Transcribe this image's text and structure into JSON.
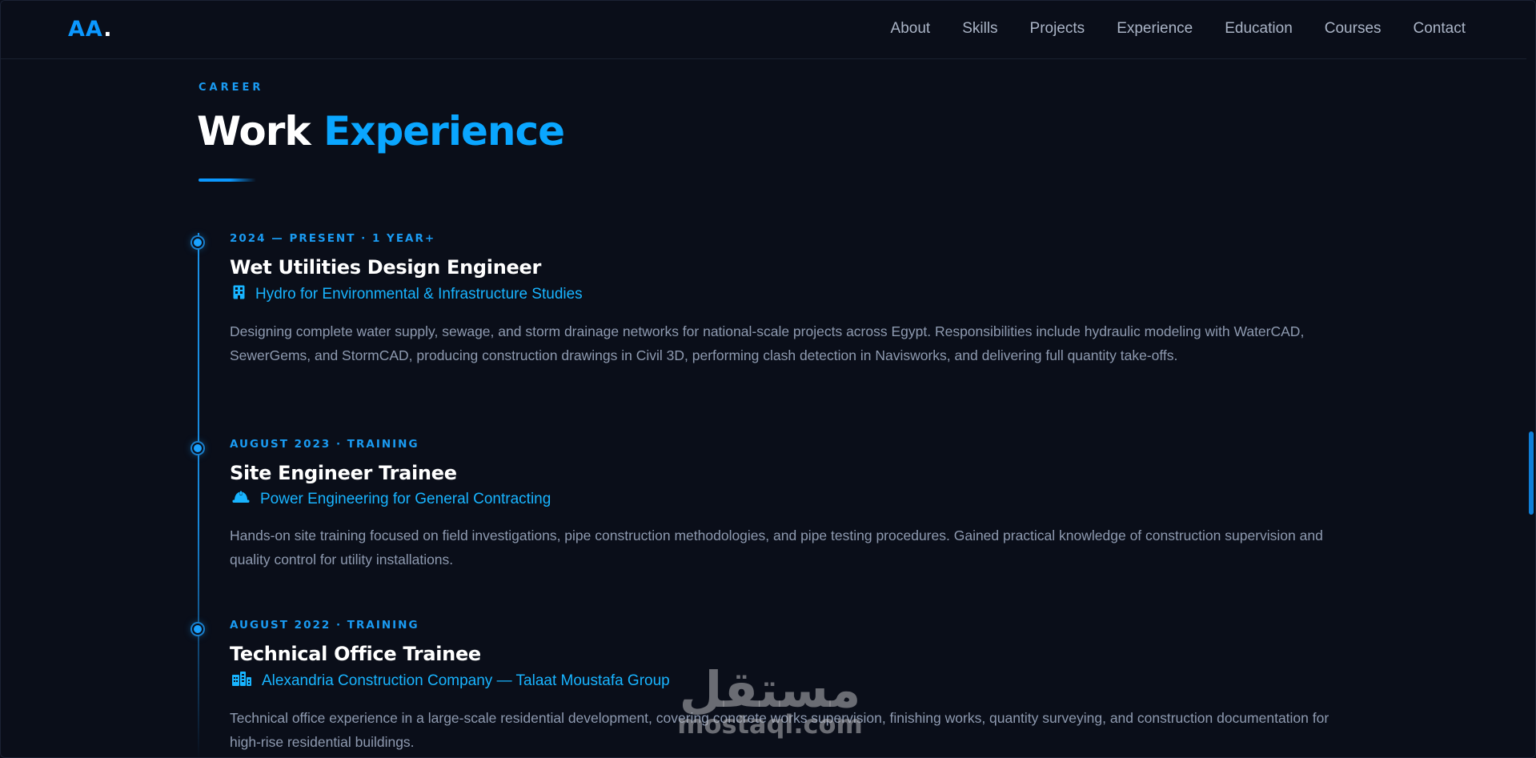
{
  "nav": {
    "logo_text": "AA",
    "logo_dot": ".",
    "links": [
      "About",
      "Skills",
      "Projects",
      "Experience",
      "Education",
      "Courses",
      "Contact"
    ]
  },
  "section": {
    "eyebrow": "CAREER",
    "title_main": "Work",
    "title_accent": "Experience"
  },
  "experience": [
    {
      "period": "2024 — PRESENT · 1 YEAR+",
      "role": "Wet Utilities Design Engineer",
      "company": "Hydro for Environmental & Infrastructure Studies",
      "icon": "building-icon",
      "description": "Designing complete water supply, sewage, and storm drainage networks for national-scale projects across Egypt. Responsibilities include hydraulic modeling with WaterCAD, SewerGems, and StormCAD, producing construction drawings in Civil 3D, performing clash detection in Navisworks, and delivering full quantity take-offs."
    },
    {
      "period": "AUGUST 2023 · TRAINING",
      "role": "Site Engineer Trainee",
      "company": "Power Engineering for General Contracting",
      "icon": "hard-hat-icon",
      "description": "Hands-on site training focused on field investigations, pipe construction methodologies, and pipe testing procedures. Gained practical knowledge of construction supervision and quality control for utility installations."
    },
    {
      "period": "AUGUST 2022 · TRAINING",
      "role": "Technical Office Trainee",
      "company": "Alexandria Construction Company — Talaat Moustafa Group",
      "icon": "city-icon",
      "description": "Technical office experience in a large-scale residential development, covering concrete works supervision, finishing works, quantity surveying, and construction documentation for high-rise residential buildings."
    }
  ],
  "watermark": {
    "arabic": "مستقل",
    "latin": "mostaql.com"
  },
  "colors": {
    "background": "#0a0e19",
    "accent": "#0b98ff",
    "company_text": "#18b4ff",
    "body_text": "#8e9ab0"
  }
}
